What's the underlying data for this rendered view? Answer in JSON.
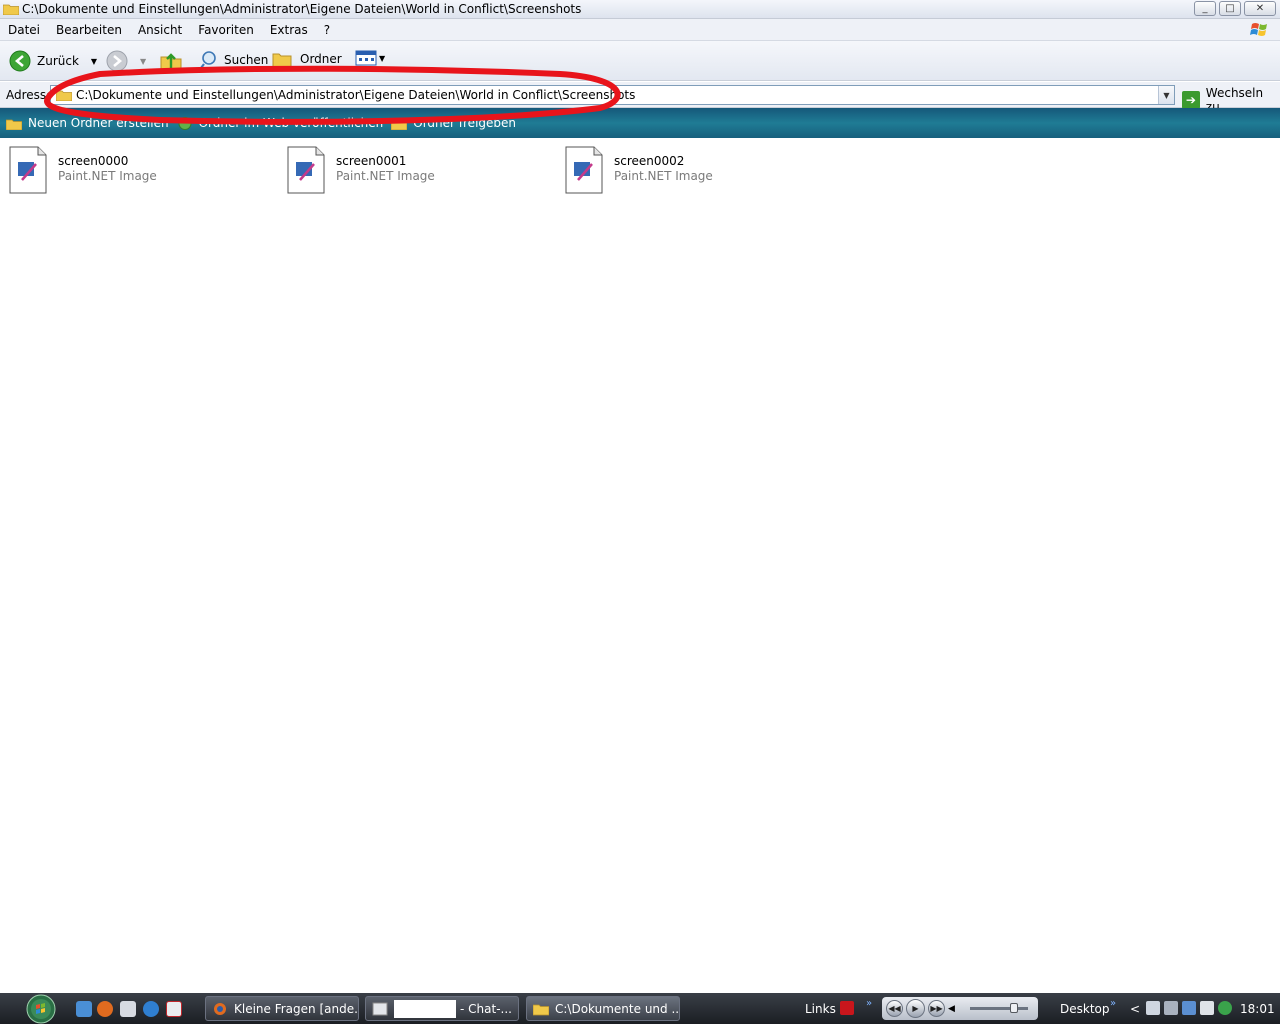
{
  "window": {
    "title": "C:\\Dokumente und Einstellungen\\Administrator\\Eigene Dateien\\World in Conflict\\Screenshots",
    "controls": {
      "minimize": "_",
      "maximize": "□",
      "close": "✕"
    }
  },
  "menu": [
    "Datei",
    "Bearbeiten",
    "Ansicht",
    "Favoriten",
    "Extras",
    "?"
  ],
  "toolbar": {
    "back_label": "Zurück",
    "search_label": "Suchen",
    "folders_label": "Ordner"
  },
  "address": {
    "label": "Adresse",
    "value": "C:\\Dokumente und Einstellungen\\Administrator\\Eigene Dateien\\World in Conflict\\Screenshots",
    "go_label": "Wechseln zu"
  },
  "tasks": [
    "Neuen Ordner erstellen",
    "Ordner im Web veröffentlichen",
    "Ordner freigeben"
  ],
  "files": [
    {
      "name": "screen0000",
      "type": "Paint.NET Image"
    },
    {
      "name": "screen0001",
      "type": "Paint.NET Image"
    },
    {
      "name": "screen0002",
      "type": "Paint.NET Image"
    }
  ],
  "taskbar": {
    "buttons": [
      "Kleine Fragen [ande...",
      "- Chat-...",
      "C:\\Dokumente und ..."
    ],
    "links_label": "Links",
    "desktop_label": "Desktop",
    "clock": "18:01"
  },
  "colors": {
    "tasks_bar": "#1f7c95",
    "annotation": "#e8141b",
    "taskbar": "#1b1e23"
  },
  "icons": [
    "folder-icon",
    "back-arrow-icon",
    "forward-arrow-icon",
    "folder-up-icon",
    "search-icon",
    "folders-icon",
    "views-icon",
    "go-arrow-icon",
    "paint-net-file-icon",
    "windows-orb-icon"
  ]
}
